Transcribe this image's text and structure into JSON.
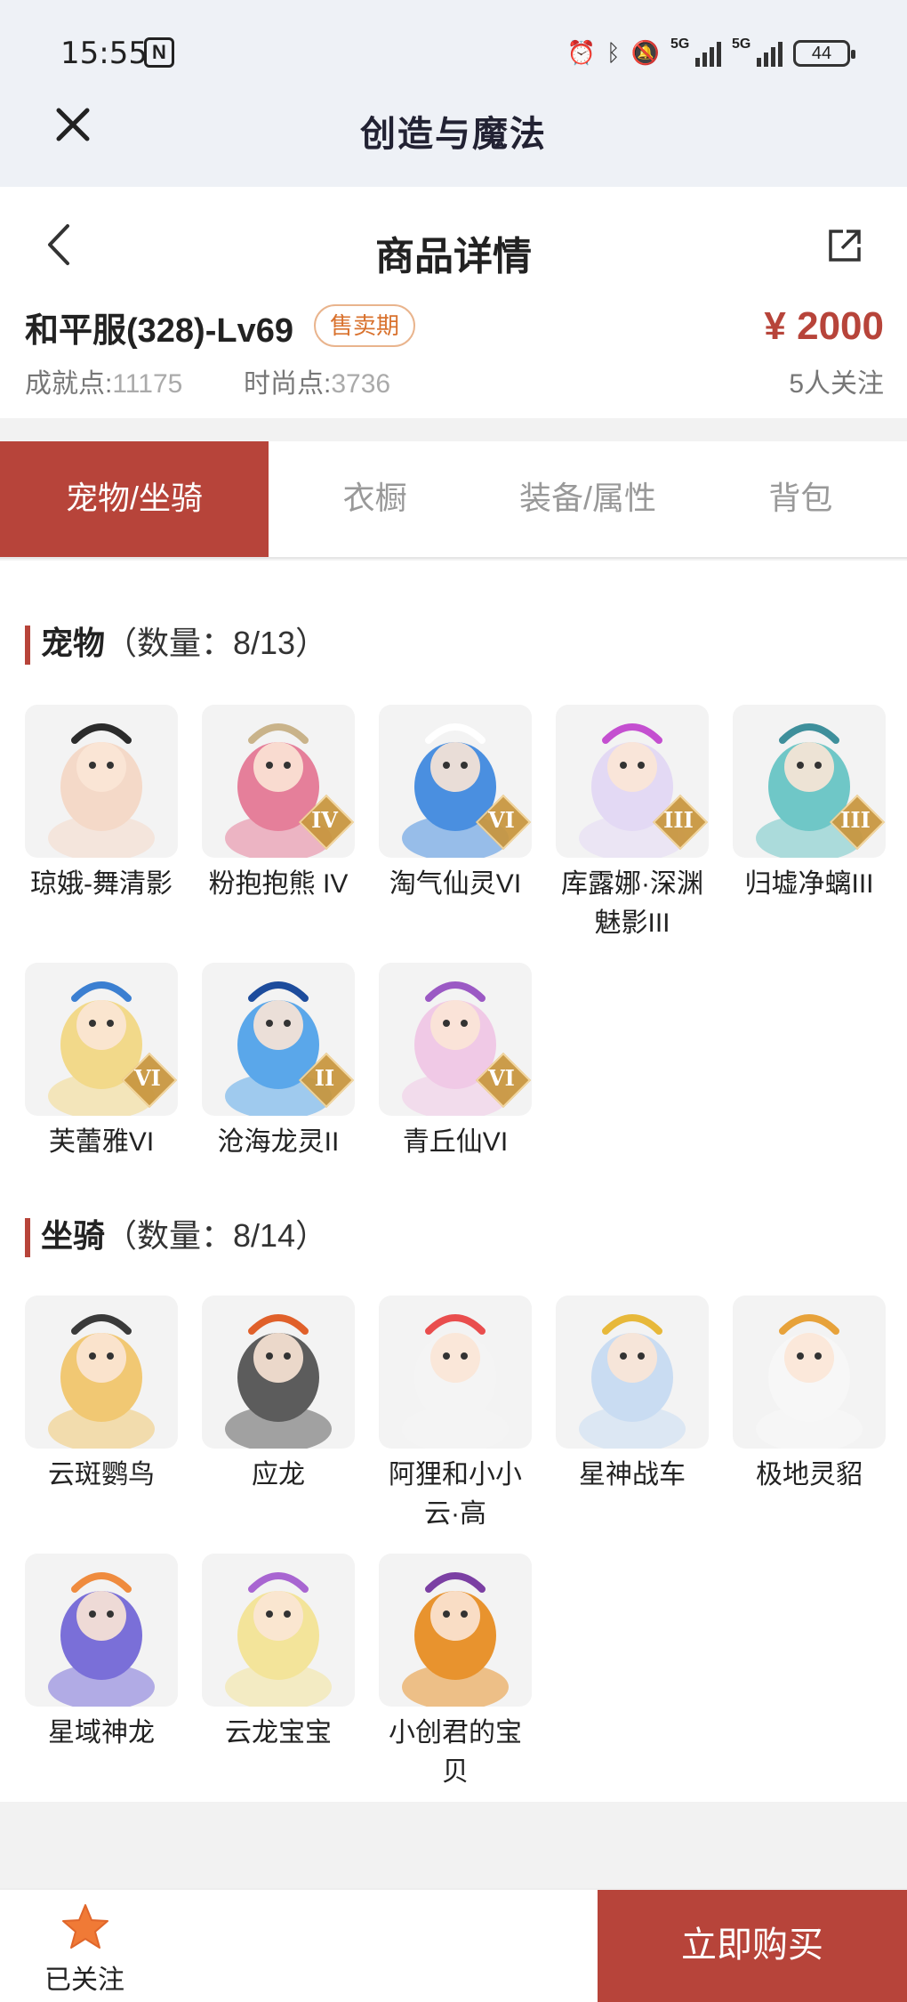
{
  "status": {
    "time": "15:55",
    "signal_label_1": "5G",
    "signal_label_2": "5G",
    "battery": "44"
  },
  "app": {
    "title": "创造与魔法"
  },
  "header": {
    "page_title": "商品详情",
    "product_name": "和平服(328)-Lv69",
    "badge": "售卖期",
    "price": "¥ 2000",
    "achievement_label": "成就点:",
    "achievement_value": "11175",
    "fashion_label": "时尚点:",
    "fashion_value": "3736",
    "followers": "5人关注"
  },
  "tabs": [
    {
      "label": "宠物/坐骑",
      "active": true
    },
    {
      "label": "衣橱",
      "active": false
    },
    {
      "label": "装备/属性",
      "active": false
    },
    {
      "label": "背包",
      "active": false
    }
  ],
  "pets": {
    "title": "宠物",
    "count": "（数量：8/13）",
    "items": [
      {
        "name": "琼娥-舞清影",
        "color": "#f4d9c8",
        "accent": "#2b2b2b",
        "tier": ""
      },
      {
        "name": "粉抱抱熊 IV",
        "color": "#e57f9a",
        "accent": "#c9b38a",
        "tier": "IV"
      },
      {
        "name": "淘气仙灵VI",
        "color": "#4a8fe0",
        "accent": "#ffffff",
        "tier": "VI"
      },
      {
        "name": "库露娜·深渊魅影III",
        "color": "#e3d9f4",
        "accent": "#c44fd0",
        "tier": "III"
      },
      {
        "name": "归墟净螭III",
        "color": "#6fc7c7",
        "accent": "#3e8f9b",
        "tier": "III"
      },
      {
        "name": "芙蕾雅VI",
        "color": "#f2d98a",
        "accent": "#3b7fd1",
        "tier": "VI"
      },
      {
        "name": "沧海龙灵II",
        "color": "#5aa7ea",
        "accent": "#1d4c9c",
        "tier": "II"
      },
      {
        "name": "青丘仙VI",
        "color": "#f0c9e6",
        "accent": "#9b59c4",
        "tier": "VI"
      }
    ]
  },
  "mounts": {
    "title": "坐骑",
    "count": "（数量：8/14）",
    "items": [
      {
        "name": "云斑鹦鸟",
        "color": "#f1c873",
        "accent": "#3a3a3a",
        "tier": ""
      },
      {
        "name": "应龙",
        "color": "#5c5c5c",
        "accent": "#e0602a",
        "tier": ""
      },
      {
        "name": "阿狸和小小云·高",
        "color": "#f4f4f4",
        "accent": "#e94d4d",
        "tier": ""
      },
      {
        "name": "星神战车",
        "color": "#c9dcf2",
        "accent": "#e7b83a",
        "tier": ""
      },
      {
        "name": "极地灵貂",
        "color": "#f7f7f7",
        "accent": "#e7a23a",
        "tier": ""
      },
      {
        "name": "星域神龙",
        "color": "#7a6fd8",
        "accent": "#ef8b3e",
        "tier": ""
      },
      {
        "name": "云龙宝宝",
        "color": "#f3e49a",
        "accent": "#a865d1",
        "tier": ""
      },
      {
        "name": "小创君的宝贝",
        "color": "#e8932e",
        "accent": "#7b3fa3",
        "tier": ""
      }
    ]
  },
  "bottom": {
    "follow_label": "已关注",
    "buy_label": "立即购买"
  },
  "colors": {
    "accent": "#b7443a",
    "badge_text": "#d9722e",
    "star": "#f07a36"
  }
}
